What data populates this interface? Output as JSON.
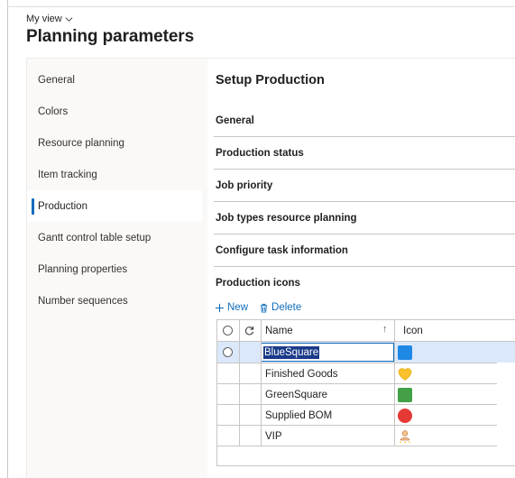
{
  "header": {
    "my_view": "My view",
    "title": "Planning parameters"
  },
  "nav": {
    "items": [
      {
        "label": "General",
        "active": false
      },
      {
        "label": "Colors",
        "active": false
      },
      {
        "label": "Resource planning",
        "active": false
      },
      {
        "label": "Item tracking",
        "active": false
      },
      {
        "label": "Production",
        "active": true
      },
      {
        "label": "Gantt control table setup",
        "active": false
      },
      {
        "label": "Planning properties",
        "active": false
      },
      {
        "label": "Number sequences",
        "active": false
      }
    ]
  },
  "panel": {
    "title": "Setup Production",
    "sections": [
      "General",
      "Production status",
      "Job priority",
      "Job types resource planning",
      "Configure task information",
      "Production icons"
    ]
  },
  "toolbar": {
    "new_label": "New",
    "delete_label": "Delete"
  },
  "grid": {
    "columns": {
      "name": "Name",
      "icon": "Icon"
    },
    "rows": [
      {
        "name": "BlueSquare",
        "icon": "blue-square-icon",
        "selected": true
      },
      {
        "name": "Finished Goods",
        "icon": "yellow-heart-icon",
        "selected": false
      },
      {
        "name": "GreenSquare",
        "icon": "green-square-icon",
        "selected": false
      },
      {
        "name": "Supplied BOM",
        "icon": "red-circle-icon",
        "selected": false
      },
      {
        "name": "VIP",
        "icon": "vip-person-icon",
        "selected": false
      }
    ]
  },
  "colors": {
    "accent": "#0f6cbd",
    "selected_row": "#dbe8fb",
    "blue_square": "#1e88e5",
    "green_square": "#43a047",
    "red_circle": "#e53935",
    "yellow_heart": "#fbc02d"
  }
}
